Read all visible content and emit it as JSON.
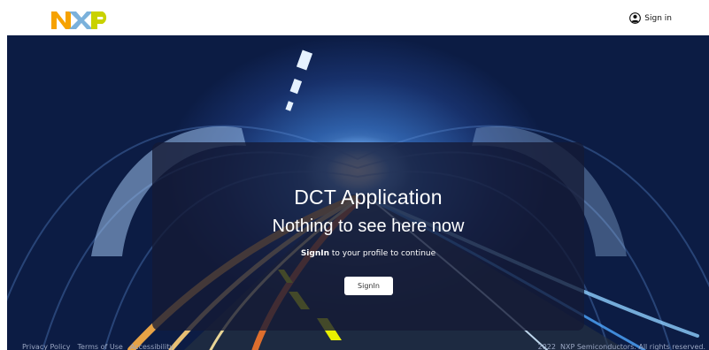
{
  "header": {
    "logo_text": "NXP",
    "signin_label": "Sign in"
  },
  "hero": {
    "title": "DCT Application",
    "subtitle": "Nothing to see here now",
    "message_bold": "SignIn",
    "message_rest": " to your profile to continue",
    "button_label": "SignIn"
  },
  "footer": {
    "links": [
      "Privacy Policy",
      "Terms of Use",
      "Accessibility"
    ],
    "copyright": "2022  NXP Semiconductors. All rights reserved."
  },
  "colors": {
    "logo_orange": "#f6a200",
    "logo_blue": "#7bb1db",
    "logo_green": "#c9d200",
    "panel_bg": "#141a34"
  },
  "icons": {
    "user": "user-circle-icon"
  }
}
